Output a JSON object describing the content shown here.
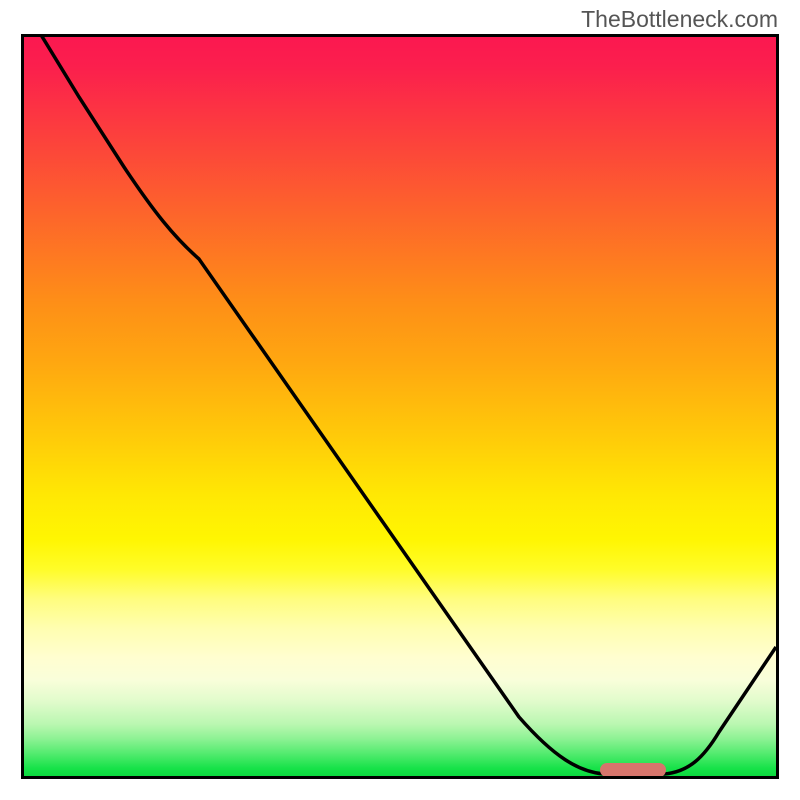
{
  "branding": {
    "attribution": "TheBottleneck.com"
  },
  "chart_data": {
    "type": "line",
    "x": [
      0.0,
      0.06,
      0.12,
      0.18,
      0.24,
      0.3,
      0.36,
      0.42,
      0.48,
      0.54,
      0.6,
      0.66,
      0.72,
      0.78,
      0.82,
      0.86,
      0.9,
      1.0
    ],
    "values": [
      1.04,
      0.92,
      0.82,
      0.76,
      0.7,
      0.6,
      0.5,
      0.4,
      0.3,
      0.2,
      0.1,
      0.05,
      0.02,
      0.0,
      0.0,
      0.02,
      0.06,
      0.18
    ],
    "series_name": "bottleneck-curve",
    "title": "",
    "xlabel": "",
    "ylabel": "",
    "xlim": [
      0,
      1
    ],
    "ylim": [
      0,
      1
    ],
    "gradient_stops": [
      {
        "pos": 0.0,
        "color": "#fb1850"
      },
      {
        "pos": 0.5,
        "color": "#ffca09"
      },
      {
        "pos": 0.75,
        "color": "#fffd7e"
      },
      {
        "pos": 1.0,
        "color": "#0cda3f"
      }
    ],
    "marker": {
      "x_start": 0.77,
      "x_end": 0.85,
      "y": 0.0,
      "color": "#d7756c"
    }
  }
}
